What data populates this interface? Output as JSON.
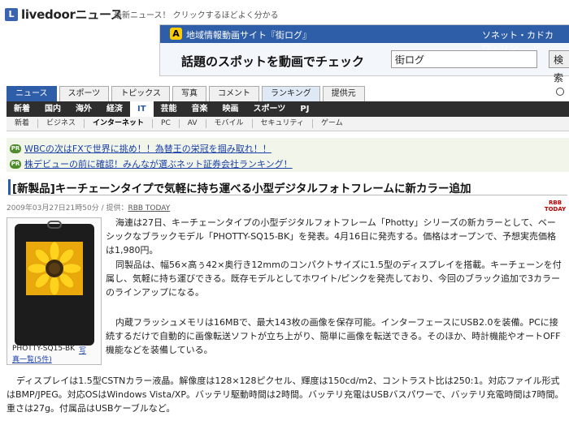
{
  "header": {
    "logo_mark": "L",
    "logo_text": "livedoorニュース",
    "tagline": "最新ニュース！ クリックするほどよく分かる"
  },
  "ad": {
    "warning_glyph": "A",
    "bar_title": "地域情報動画サイト『街ログ』",
    "bar_right": "ソネット・カドカワ・リン",
    "headline": "話題のスポットを動画でチェック",
    "input_value": "街ログ",
    "button": "検索"
  },
  "nav": {
    "main_tabs": [
      {
        "label": "ニュース",
        "active": true
      },
      {
        "label": "スポーツ"
      },
      {
        "label": "トピックス"
      },
      {
        "label": "写真"
      },
      {
        "label": "コメント"
      },
      {
        "label": "ランキング"
      },
      {
        "label": "提供元"
      }
    ],
    "sub_tabs": [
      "新着",
      "国内",
      "海外",
      "経済",
      "IT",
      "芸能",
      "音楽",
      "映画",
      "スポーツ",
      "PJ"
    ],
    "sub_active": "IT",
    "tert_tabs": [
      "新着",
      "ビジネス",
      "インターネット",
      "PC",
      "AV",
      "モバイル",
      "セキュリティ",
      "ゲーム"
    ],
    "tert_active": "インターネット"
  },
  "pr": {
    "badge": "PR",
    "items": [
      "WBCの次はFXで世界に挑め！！為替王の栄冠を掴み取れ！！",
      "株デビューの前に確認！みんなが選ぶネット証券会社ランキング！"
    ]
  },
  "article": {
    "title": "[新製品]キーチェーンタイプで気軽に持ち運べる小型デジタルフォトフレームに新カラー追加",
    "meta_prefix": "2009年03月27日21時50分 / 提供：",
    "source": "RBB TODAY",
    "source_logo": "RBB TODAY",
    "caption_model": "PHOTTY-SQ15-BK",
    "caption_link1": "写",
    "caption_link2": "真一覧(5件)",
    "p1": "海連は27日、キーチェーンタイプの小型デジタルフォトフレーム「Photty」シリーズの新カラーとして、ベーシックなブラックモデル「PHOTTY-SQ15-BK」を発表。4月16日に発売する。価格はオープンで、予想実売価格は1,980円。",
    "p2": "同製品は、幅56×高ぅ42×奥行き12mmのコンパクトサイズに1.5型のディスプレイを搭載。キーチェーンを付属し、気軽に持ち運びできる。既存モデルとしてホワイト/ピンクを発売しており、今回のブラック追加で3カラーのラインアップになる。",
    "p3": "内蔵フラッシュメモリは16MBで、最大143枚の画像を保存可能。インターフェースにUSB2.0を装備。PCに接続するだけで自動的に画像転送ソフトが立ち上がり、簡単に画像を転送できる。そのほか、時計機能やオートOFF機能などを装備している。",
    "p4": "ディスプレイは1.5型CSTNカラー液晶。解像度は128×128ピクセル、輝度は150cd/m2、コントラスト比は250:1。対応ファイル形式はBMP/JPEG。対応OSはWindows Vista/XP。バッテリ駆動時間は2時間。バッテリ充電はUSBバスパワーで、バッテリ充電時間は7時間。重さは27g。付属品はUSBケーブルなど。"
  }
}
